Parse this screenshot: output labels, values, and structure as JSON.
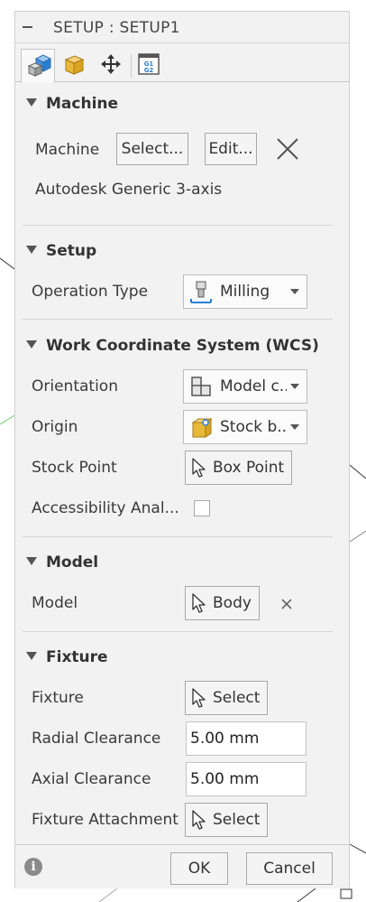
{
  "dialog": {
    "title": "SETUP : SETUP1"
  },
  "tabs": [
    {
      "icon": "setup-tab-icon",
      "active": true
    },
    {
      "icon": "stock-tab-icon",
      "active": false
    },
    {
      "icon": "post-process-tab-icon",
      "active": false
    },
    {
      "icon": "nc-program-tab-icon",
      "active": false
    }
  ],
  "machine": {
    "header": "Machine",
    "label": "Machine",
    "select_label": "Select...",
    "edit_label": "Edit...",
    "machine_name": "Autodesk Generic 3-axis"
  },
  "setup": {
    "header": "Setup",
    "operation_type_label": "Operation Type",
    "operation_type_value": "Milling"
  },
  "wcs": {
    "header": "Work Coordinate System (WCS)",
    "orientation_label": "Orientation",
    "orientation_value": "Model c...",
    "origin_label": "Origin",
    "origin_value": "Stock b...",
    "stock_point_label": "Stock Point",
    "stock_point_button": "Box Point",
    "accessibility_label": "Accessibility Anal..."
  },
  "model": {
    "header": "Model",
    "label": "Model",
    "value": "Body"
  },
  "fixture": {
    "header": "Fixture",
    "fixture_label": "Fixture",
    "fixture_button": "Select",
    "radial_label": "Radial Clearance",
    "radial_value": "5.00 mm",
    "axial_label": "Axial Clearance",
    "axial_value": "5.00 mm",
    "attachment_label": "Fixture Attachment",
    "attachment_button": "Select"
  },
  "footer": {
    "ok_label": "OK",
    "cancel_label": "Cancel"
  },
  "colors": {
    "accent": "#2a7fd4",
    "panel_bg": "#f2f2f2",
    "stock_yellow": "#e8b83a"
  }
}
